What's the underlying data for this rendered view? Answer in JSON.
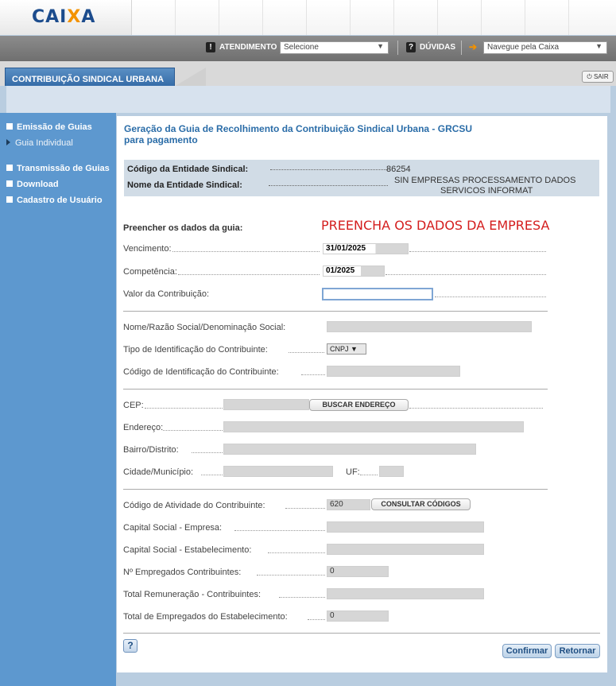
{
  "header": {
    "logo_text_a": "CAI",
    "logo_text_b": "X",
    "logo_text_c": "A",
    "atendimento_label": "ATENDIMENTO",
    "atendimento_select": "Selecione",
    "duvidas_label": "DÚVIDAS",
    "navegue_select": "Navegue pela Caixa",
    "sair_label": "SAIR"
  },
  "tab": {
    "label": "CONTRIBUIÇÃO SINDICAL URBANA"
  },
  "sidebar": {
    "items": [
      {
        "label": "Emissão de Guias"
      },
      {
        "label": "Guia Individual"
      },
      {
        "label": "Transmissão de Guias"
      },
      {
        "label": "Download"
      },
      {
        "label": "Cadastro de Usuário"
      }
    ]
  },
  "main": {
    "title_line1": "Geração da Guia de Recolhimento da Contribuição Sindical Urbana - GRCSU",
    "title_line2": "para pagamento",
    "entity": {
      "code_label": "Código da Entidade Sindical:",
      "code_value": "86254",
      "name_label": "Nome da Entidade Sindical:",
      "name_value_line1": "SIN EMPRESAS PROCESSAMENTO DADOS",
      "name_value_line2": "SERVICOS INFORMAT"
    },
    "section_label": "Preencher os dados da guia:",
    "banner": "PREENCHA OS DADOS DA EMPRESA",
    "fields": {
      "vencimento_label": "Vencimento:",
      "vencimento_value": "31/01/2025",
      "competencia_label": "Competência:",
      "competencia_value": "01/2025",
      "valor_label": "Valor da Contribuição:",
      "valor_value": "",
      "nome_label": "Nome/Razão Social/Denominação Social:",
      "tipo_label": "Tipo de Identificação do Contribuinte:",
      "tipo_value": "CNPJ",
      "codigo_id_label": "Código de Identificação do Contribuinte:",
      "cep_label": "CEP:",
      "buscar_label": "BUSCAR ENDEREÇO",
      "endereco_label": "Endereço:",
      "bairro_label": "Bairro/Distrito:",
      "cidade_label": "Cidade/Município:",
      "uf_label": "UF:",
      "atividade_label": "Código de Atividade do Contribuinte:",
      "atividade_value": "620",
      "consultar_label": "CONSULTAR CÓDIGOS",
      "capital_empresa_label": "Capital Social - Empresa:",
      "capital_estab_label": "Capital Social - Estabelecimento:",
      "num_empregados_label": "Nº Empregados Contribuintes:",
      "num_empregados_value": "0",
      "total_remun_label": "Total Remuneração - Contribuintes:",
      "total_empregados_label": "Total de Empregados do Estabelecimento:",
      "total_empregados_value": "0"
    },
    "help_label": "?",
    "confirmar_label": "Confirmar",
    "retornar_label": "Retornar"
  }
}
